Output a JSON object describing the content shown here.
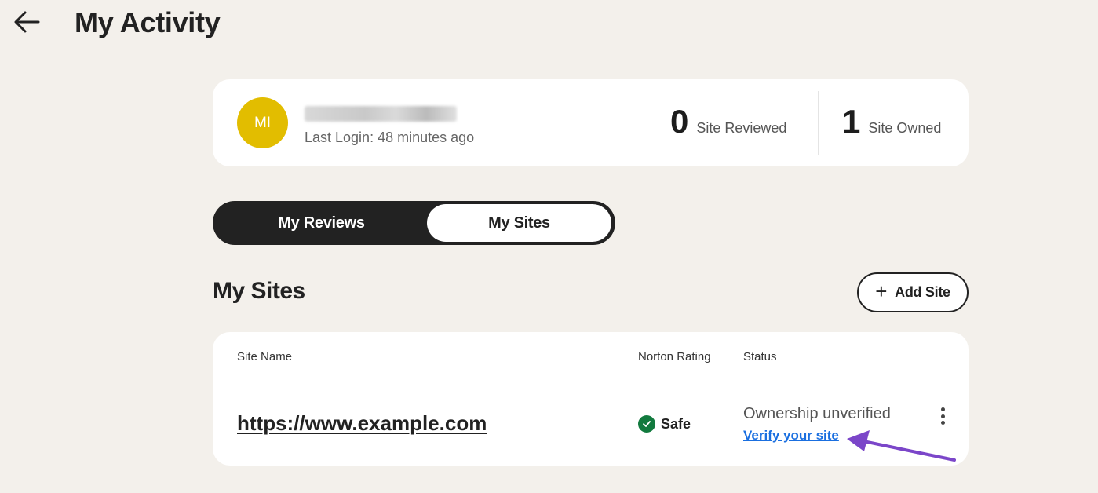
{
  "header": {
    "back_icon": "arrow-left-icon",
    "title": "My Activity"
  },
  "profile": {
    "avatar_initials": "MI",
    "avatar_color": "#e2bd00",
    "username": "[redacted]",
    "last_login": "Last Login: 48 minutes ago",
    "stats": [
      {
        "value": "0",
        "label": "Site Reviewed"
      },
      {
        "value": "1",
        "label": "Site Owned"
      }
    ]
  },
  "tabs": [
    {
      "label": "My Reviews",
      "active": false
    },
    {
      "label": "My Sites",
      "active": true
    }
  ],
  "section": {
    "title": "My Sites",
    "add_button_icon": "plus-icon",
    "add_button_label": "Add Site"
  },
  "table": {
    "columns": [
      "Site Name",
      "Norton Rating",
      "Status"
    ],
    "rows": [
      {
        "site_name": "https://www.example.com",
        "rating": "Safe",
        "rating_icon": "check-circle-icon",
        "rating_color": "#127a3e",
        "status": "Ownership unverified",
        "action_link": "Verify your site",
        "menu_icon": "kebab-menu-icon"
      }
    ]
  },
  "annotation": {
    "type": "arrow",
    "color": "#7b46c9",
    "points_to": "Verify your site"
  }
}
